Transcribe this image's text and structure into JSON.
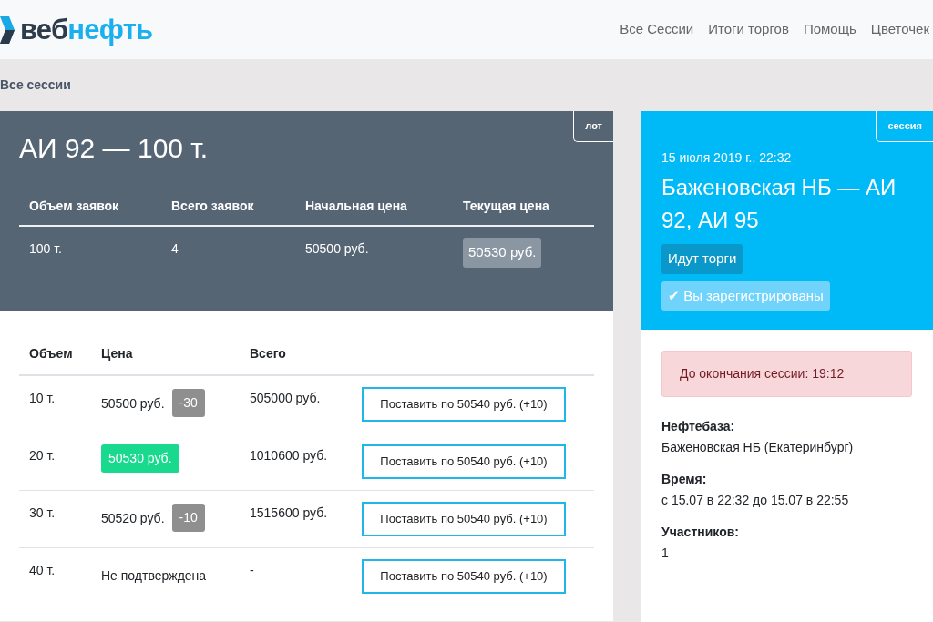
{
  "header": {
    "logo": {
      "dark": "веб",
      "accent": "нефть"
    },
    "nav": [
      "Все Сессии",
      "Итоги торгов",
      "Помощь",
      "Цветочек"
    ]
  },
  "breadcrumb": "Все сессии",
  "lot": {
    "tag": "лот",
    "title": "АИ 92 — 100 т.",
    "columns": [
      "Объем заявок",
      "Всего заявок",
      "Начальная цена",
      "Текущая цена"
    ],
    "values": [
      "100 т.",
      "4",
      "50500 руб."
    ],
    "current_price": "50530 руб."
  },
  "bids": {
    "columns": [
      "Объем",
      "Цена",
      "Всего"
    ],
    "rows": [
      {
        "volume": "10 т.",
        "price": "50500 руб.",
        "kind": "delta",
        "delta": "-30",
        "total": "505000 руб.",
        "button": "Поставить по 50540 руб. (+10)"
      },
      {
        "volume": "20 т.",
        "price": "50530 руб.",
        "kind": "best",
        "total": "1010600 руб.",
        "button": "Поставить по 50540 руб. (+10)"
      },
      {
        "volume": "30 т.",
        "price": "50520 руб.",
        "kind": "delta",
        "delta": "-10",
        "total": "1515600 руб.",
        "button": "Поставить по 50540 руб. (+10)"
      },
      {
        "volume": "40 т.",
        "price": "Не подтверждена",
        "kind": "plain",
        "total": "-",
        "button": "Поставить по 50540 руб. (+10)"
      }
    ]
  },
  "session": {
    "tag": "сессия",
    "date": "15 июля 2019 г., 22:32",
    "title": "Баженовская НБ — АИ 92, АИ 95",
    "status": "Идут торги",
    "registered": true,
    "registered_label": "✔ Вы зарегистрированы",
    "countdown": "До окончания сессии: 19:12",
    "details": [
      {
        "label": "Нефтебаза:",
        "value": "Баженовская НБ (Екатеринбург)"
      },
      {
        "label": "Время:",
        "value": "с 15.07 в 22:32 до 15.07 в 22:55"
      },
      {
        "label": "Участников:",
        "value": "1"
      }
    ]
  }
}
